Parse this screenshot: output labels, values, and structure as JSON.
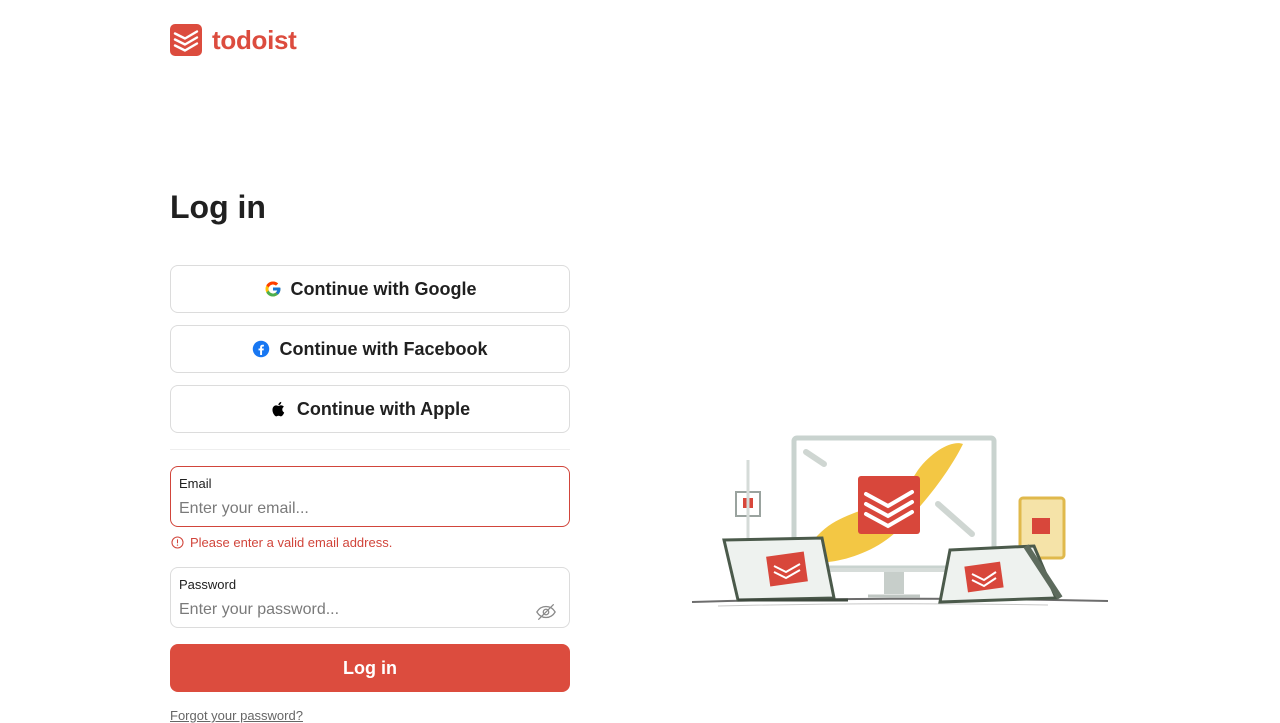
{
  "brand": {
    "name": "todoist",
    "color": "#dc4c3e",
    "icon": "todoist-logo-icon"
  },
  "page": {
    "title": "Log in"
  },
  "social": {
    "google": {
      "label": "Continue with Google",
      "icon": "google-icon"
    },
    "facebook": {
      "label": "Continue with Facebook",
      "icon": "facebook-icon"
    },
    "apple": {
      "label": "Continue with Apple",
      "icon": "apple-icon"
    }
  },
  "form": {
    "email": {
      "label": "Email",
      "placeholder": "Enter your email...",
      "value": "",
      "error": "Please enter a valid email address."
    },
    "password": {
      "label": "Password",
      "placeholder": "Enter your password...",
      "value": "",
      "toggle_icon": "eye-off-icon"
    },
    "submit_label": "Log in",
    "forgot_label": "Forgot your password?"
  },
  "colors": {
    "accent": "#dc4c3e",
    "error": "#d1453b",
    "border": "#dcdcdc"
  },
  "illustration": {
    "name": "devices-illustration"
  }
}
